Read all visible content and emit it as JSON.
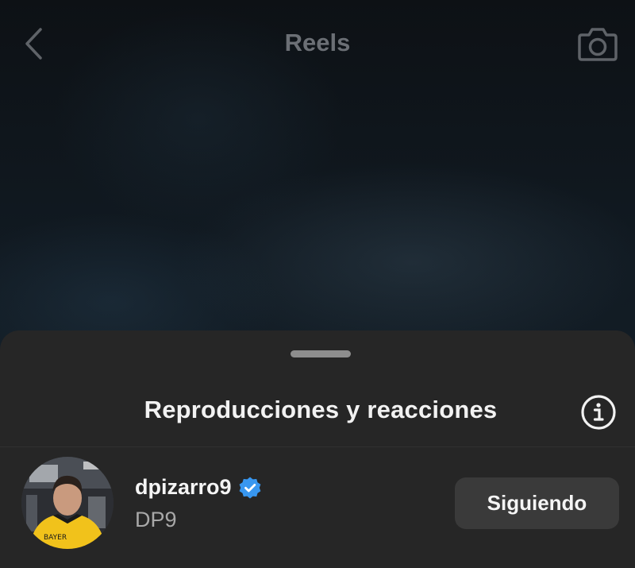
{
  "header": {
    "title": "Reels",
    "back_icon": "chevron-left-icon",
    "camera_icon": "camera-icon"
  },
  "sheet": {
    "title": "Reproducciones y reacciones",
    "info_icon": "info-icon"
  },
  "user": {
    "username": "dpizarro9",
    "full_name": "DP9",
    "verified": true,
    "avatar_jersey_text": "BAYER",
    "follow_label": "Siguiendo"
  },
  "colors": {
    "sheet_bg": "#262626",
    "button_bg": "#3a3a3a",
    "verified_blue": "#3897f0",
    "muted_text": "#a8a8a8"
  }
}
